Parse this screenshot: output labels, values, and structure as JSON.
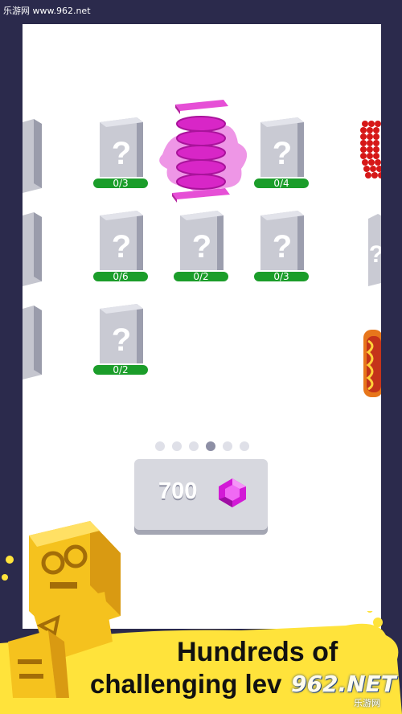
{
  "watermark": {
    "top": "乐游网 www.962.net",
    "bottom_logo": "962.NET",
    "bottom_sub": "乐游网"
  },
  "levels": [
    {
      "progress": "0/3",
      "locked": true
    },
    {
      "progress": "",
      "locked": false,
      "icon": "pink-spring-icon"
    },
    {
      "progress": "0/4",
      "locked": true
    },
    {
      "progress": "0/6",
      "locked": true
    },
    {
      "progress": "0/2",
      "locked": true
    },
    {
      "progress": "0/3",
      "locked": true
    },
    {
      "progress": "0/2",
      "locked": true
    }
  ],
  "pagination": {
    "total": 6,
    "active_index": 3
  },
  "gems": {
    "count": "700",
    "icon": "gem-icon",
    "color": "#d21ad6"
  },
  "banner": {
    "line1": "Hundreds of",
    "line2": "challenging lev"
  },
  "colors": {
    "background": "#2b2a4c",
    "badge": "#1b9d2a",
    "banner": "#ffe33b"
  }
}
